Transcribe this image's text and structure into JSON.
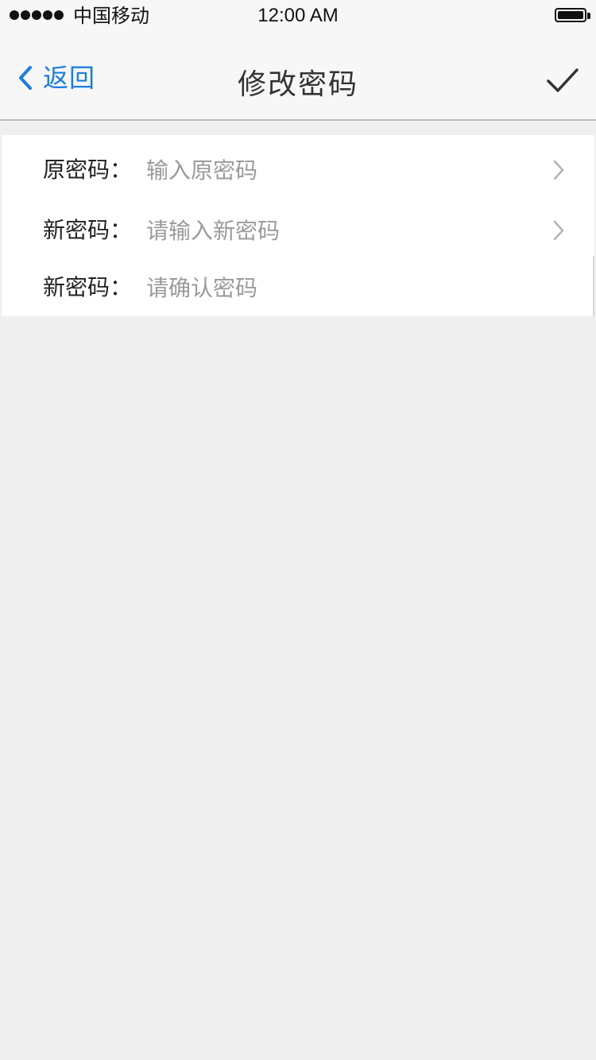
{
  "status_bar": {
    "carrier": "中国移动",
    "time": "12:00 AM",
    "signal_icon": "signal-dots-icon",
    "battery_icon": "battery-full-icon"
  },
  "nav": {
    "back_label": "返回",
    "back_icon": "chevron-left-icon",
    "title": "修改密码",
    "confirm_icon": "checkmark-icon"
  },
  "form": {
    "rows": [
      {
        "label": "原密码：",
        "placeholder": "输入原密码",
        "value": "",
        "chevron": true
      },
      {
        "label": "新密码：",
        "placeholder": "请输入新密码",
        "value": "",
        "chevron": true
      },
      {
        "label": "新密码：",
        "placeholder": "请确认密码",
        "value": "",
        "chevron": false
      }
    ]
  },
  "colors": {
    "accent": "#1a7ce0",
    "background": "#efefef",
    "bar_background": "#f7f7f7",
    "placeholder": "#9a9a9a",
    "text": "#222222"
  }
}
